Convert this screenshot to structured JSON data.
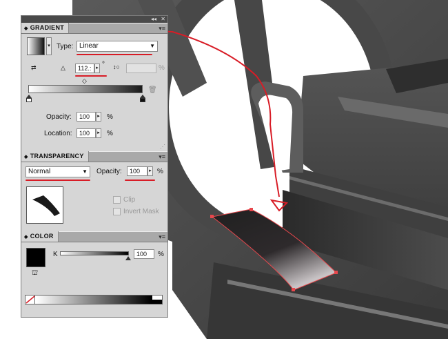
{
  "gradient_panel": {
    "title": "GRADIENT",
    "type_label": "Type:",
    "type_value": "Linear",
    "angle_value": "112.:",
    "angle_unit": "°",
    "aspect_unit": "%",
    "opacity_label": "Opacity:",
    "opacity_value": "100",
    "opacity_unit": "%",
    "location_label": "Location:",
    "location_value": "100",
    "location_unit": "%"
  },
  "transparency_panel": {
    "title": "TRANSPARENCY",
    "blend_mode": "Normal",
    "opacity_label": "Opacity:",
    "opacity_value": "100",
    "opacity_unit": "%",
    "clip_label": "Clip",
    "invert_mask_label": "Invert Mask"
  },
  "color_panel": {
    "title": "COLOR",
    "channel_label": "K",
    "channel_value": "100",
    "channel_unit": "%"
  },
  "colors": {
    "annotation_red": "#d81c26",
    "artwork_dark": "#474747",
    "selection_red": "#e8474c"
  }
}
